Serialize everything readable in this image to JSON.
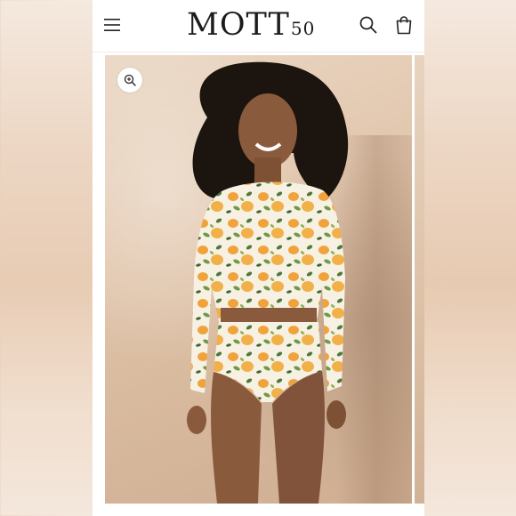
{
  "brand": {
    "name": "MOTT",
    "suffix": "50"
  },
  "header": {
    "menu_icon": "hamburger-menu-icon",
    "search_icon": "search-icon",
    "cart_icon": "shopping-bag-icon"
  },
  "gallery": {
    "zoom_icon": "zoom-in-icon",
    "image_description_colors": {
      "background": "#e2c7ae",
      "print_orange": "#f0a33a",
      "print_green": "#4f7a3a"
    }
  }
}
